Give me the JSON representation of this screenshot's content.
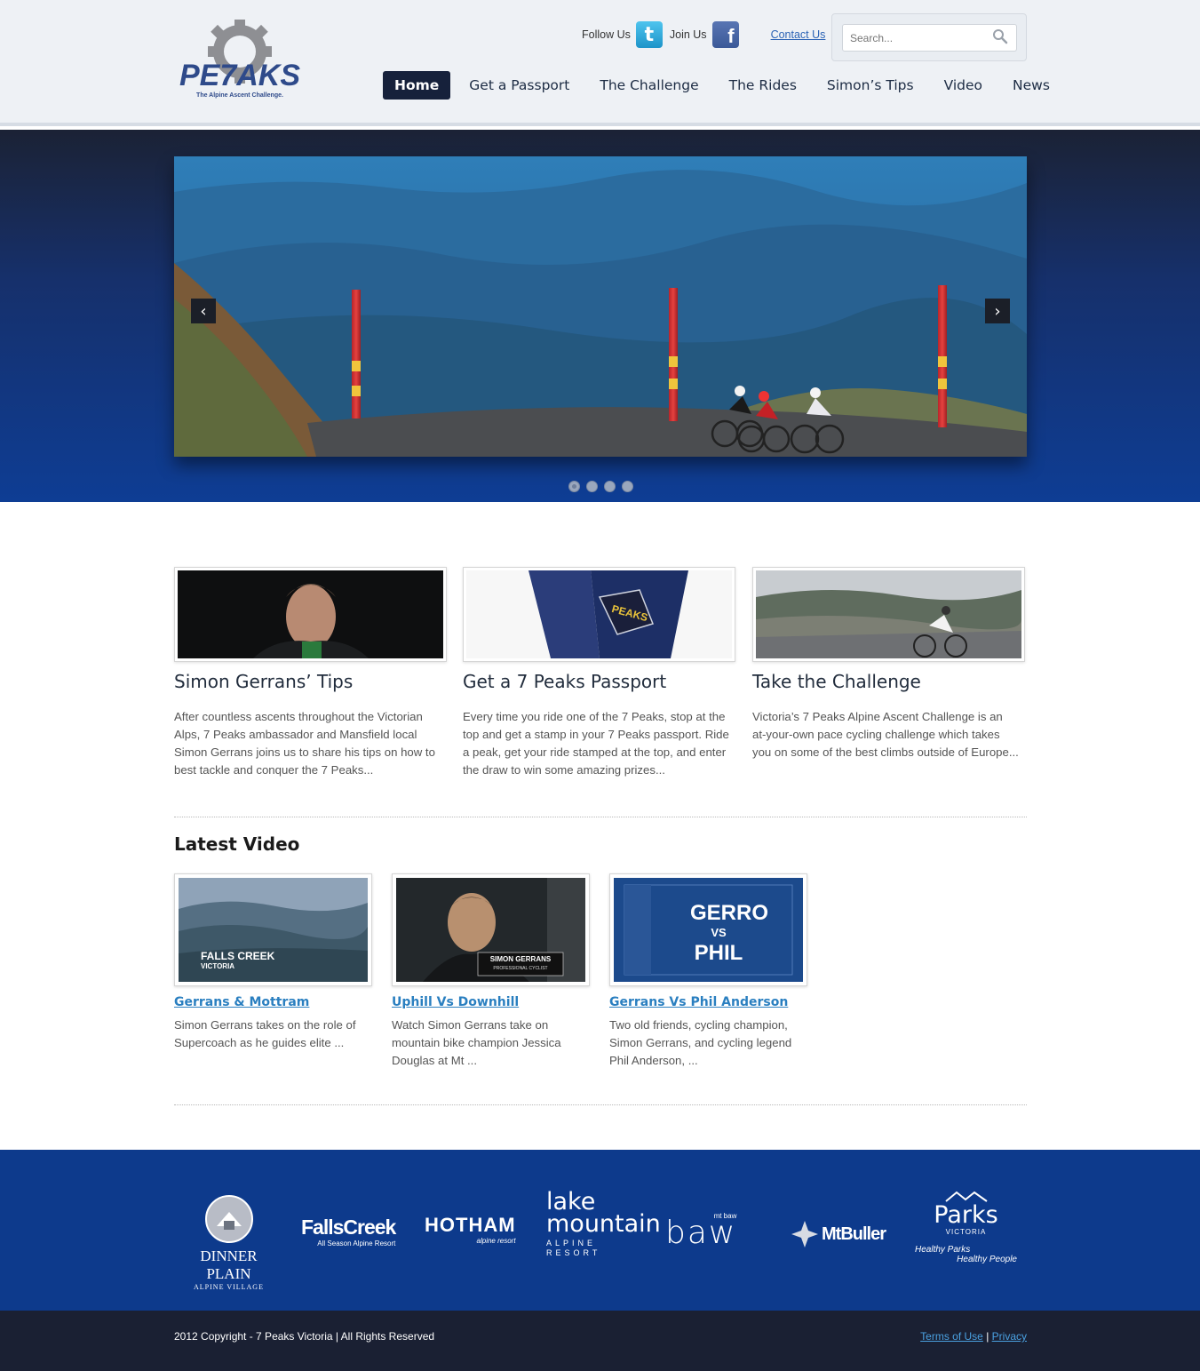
{
  "header": {
    "logo_text": "PE7AKS",
    "logo_tagline": "The Alpine Ascent Challenge.",
    "follow_label": "Follow Us",
    "join_label": "Join Us",
    "contact_label": "Contact Us",
    "search_placeholder": "Search..."
  },
  "nav": {
    "items": [
      {
        "label": "Home",
        "active": true
      },
      {
        "label": "Get a Passport"
      },
      {
        "label": "The Challenge"
      },
      {
        "label": "The Rides"
      },
      {
        "label": "Simon’s Tips"
      },
      {
        "label": "Video"
      },
      {
        "label": "News"
      }
    ]
  },
  "slider": {
    "prev_icon": "chevron-left-icon",
    "next_icon": "chevron-right-icon",
    "slide_count": 4,
    "active_index": 0
  },
  "features": [
    {
      "title": "Simon Gerrans’ Tips",
      "text": "After countless ascents throughout the Victorian Alps, 7 Peaks ambassador and Mansfield local Simon Gerrans joins us to share his tips on how to best tackle and conquer the 7 Peaks..."
    },
    {
      "title": "Get a 7 Peaks Passport",
      "text": "Every time you ride one of the 7 Peaks, stop at the top and get a stamp in your 7 Peaks passport. Ride a peak, get your ride stamped at the top, and enter the draw to win some amazing prizes..."
    },
    {
      "title": "Take the Challenge",
      "text": "Victoria’s 7 Peaks Alpine Ascent Challenge is an at-your-own pace cycling challenge which takes you on some of the best climbs outside of Europe..."
    }
  ],
  "latest_video": {
    "heading": "Latest Video",
    "videos": [
      {
        "title": "Gerrans & Mottram",
        "text": "Simon Gerrans takes on the role of Supercoach as he guides elite ...",
        "thumb_caption": "FALLS CREEK",
        "thumb_subcaption": "VICTORIA"
      },
      {
        "title": "Uphill Vs Downhill",
        "text": "Watch Simon Gerrans take on mountain bike champion Jessica Douglas at Mt ...",
        "thumb_caption": "SIMON GERRANS",
        "thumb_subcaption": "PROFESSIONAL CYCLIST"
      },
      {
        "title": "Gerrans Vs Phil Anderson",
        "text": "Two old friends, cycling champion, Simon Gerrans, and cycling legend Phil Anderson, ...",
        "thumb_caption": "GERRO",
        "thumb_vs": "VS",
        "thumb_subcaption": "PHIL"
      }
    ]
  },
  "sponsors": [
    {
      "name": "DINNER PLAIN",
      "sub": "ALPINE VILLAGE"
    },
    {
      "name": "FallsCreek",
      "sub": "All Season Alpine Resort"
    },
    {
      "name": "HOTHAM",
      "sub": "alpine resort"
    },
    {
      "name": "lake mountain",
      "sub": "ALPINE RESORT"
    },
    {
      "name": "baw",
      "sub": "mt baw"
    },
    {
      "name": "MtBuller",
      "sub": ""
    },
    {
      "name": "Parks",
      "sub": "VICTORIA",
      "tagline1": "Healthy Parks",
      "tagline2": "Healthy People"
    }
  ],
  "footer": {
    "copyright": "2012 Copyright - 7 Peaks Victoria | All Rights Reserved",
    "terms": "Terms of Use",
    "separator": "|",
    "privacy": "Privacy"
  },
  "colors": {
    "nav_active_bg": "#16213b",
    "hero_blue": "#0e3d94",
    "sponsor_band": "#0d3a8c",
    "footer_bg": "#1a2033",
    "link_blue": "#2a7fc0"
  }
}
